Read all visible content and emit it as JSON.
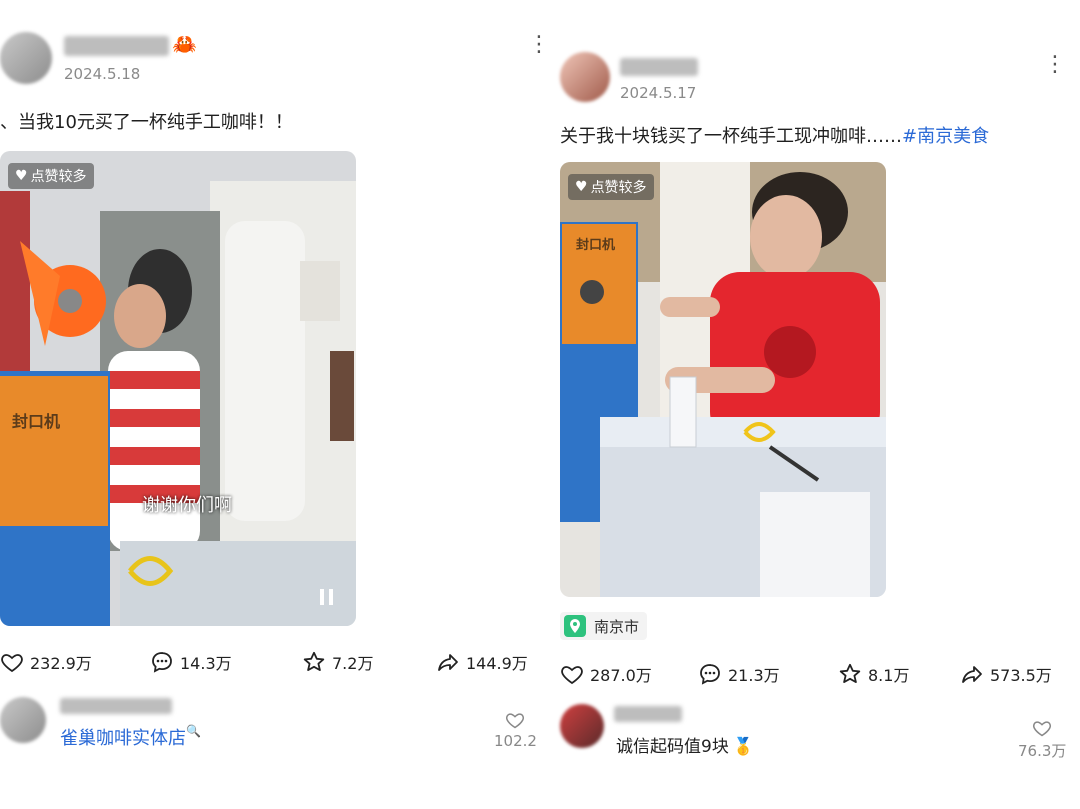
{
  "left_post": {
    "date": "2024.5.18",
    "caption": "、当我10元买了一杯纯手工咖啡！！",
    "badge": "点赞较多",
    "video_subtitle": "谢谢你们啊",
    "machine_label": "封口机",
    "stats": {
      "likes": "232.9万",
      "comments": "14.3万",
      "favorites": "7.2万",
      "shares": "144.9万"
    },
    "top_comment": {
      "text": "雀巢咖啡实体店",
      "likes": "102.2"
    }
  },
  "right_post": {
    "date": "2024.5.17",
    "caption": "关于我十块钱买了一杯纯手工现冲咖啡……",
    "hashtag": "#南京美食",
    "badge": "点赞较多",
    "machine_label": "封口机",
    "location": "南京市",
    "stats": {
      "likes": "287.0万",
      "comments": "21.3万",
      "favorites": "8.1万",
      "shares": "573.5万"
    },
    "top_comment": {
      "text": "诚信起码值9块",
      "likes": "76.3万"
    }
  },
  "icons": {
    "like": "heart-icon",
    "comment": "comment-bubble-icon",
    "favorite": "star-icon",
    "share": "share-arrow-icon",
    "location": "location-pin-icon",
    "more": "more-vertical-icon",
    "crab": "crab-emoji-icon",
    "medal": "medal-emoji-icon"
  },
  "colors": {
    "hashtag": "#2b6ad6",
    "location_pin": "#2ec27e",
    "text": "#222222",
    "muted": "#8a8a8a"
  }
}
